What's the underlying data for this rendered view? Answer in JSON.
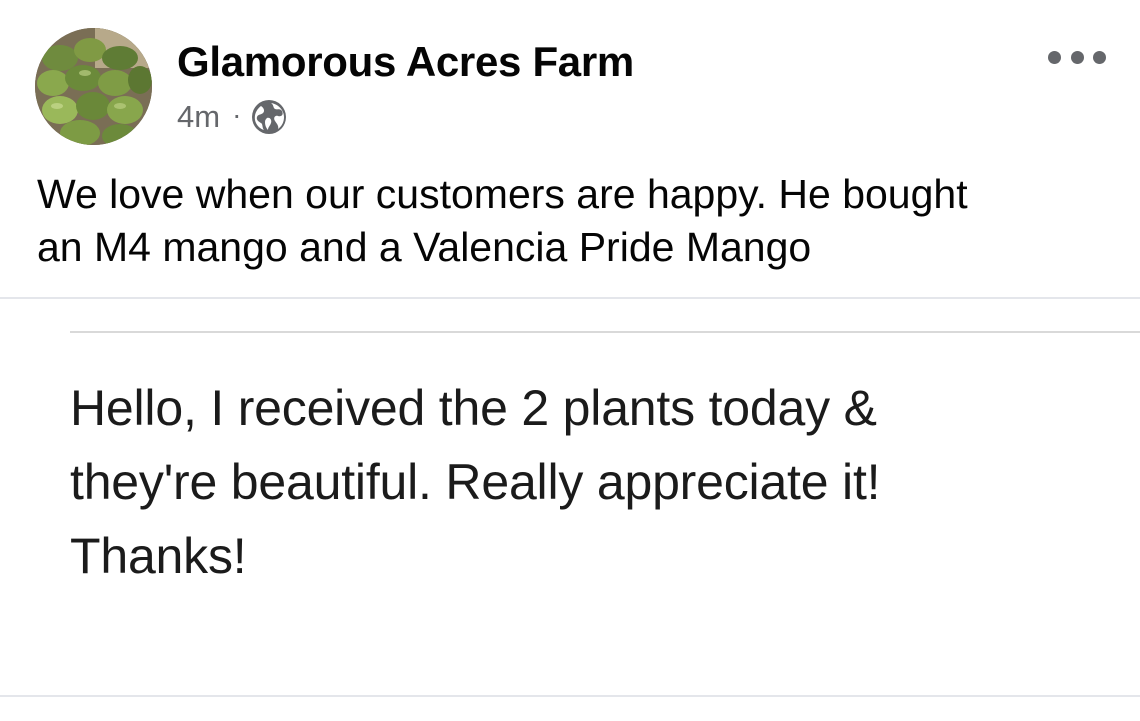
{
  "post": {
    "page_name": "Glamorous Acres Farm",
    "timestamp": "4m",
    "separator": "·",
    "audience_icon": "globe-icon",
    "avatar_icon": "mango-pile-photo",
    "more_icon": "more-dots-icon",
    "caption_line1": "We love when our customers are happy. He bought",
    "caption_line2": "an M4 mango and a Valencia Pride Mango"
  },
  "photo": {
    "message_line1": "Hello, I received the 2 plants today &",
    "message_line2": "they're beautiful. Really appreciate it!",
    "message_line3": "Thanks!"
  },
  "colors": {
    "text_primary": "#050505",
    "text_secondary": "#65676b",
    "divider": "#e4e6eb"
  }
}
